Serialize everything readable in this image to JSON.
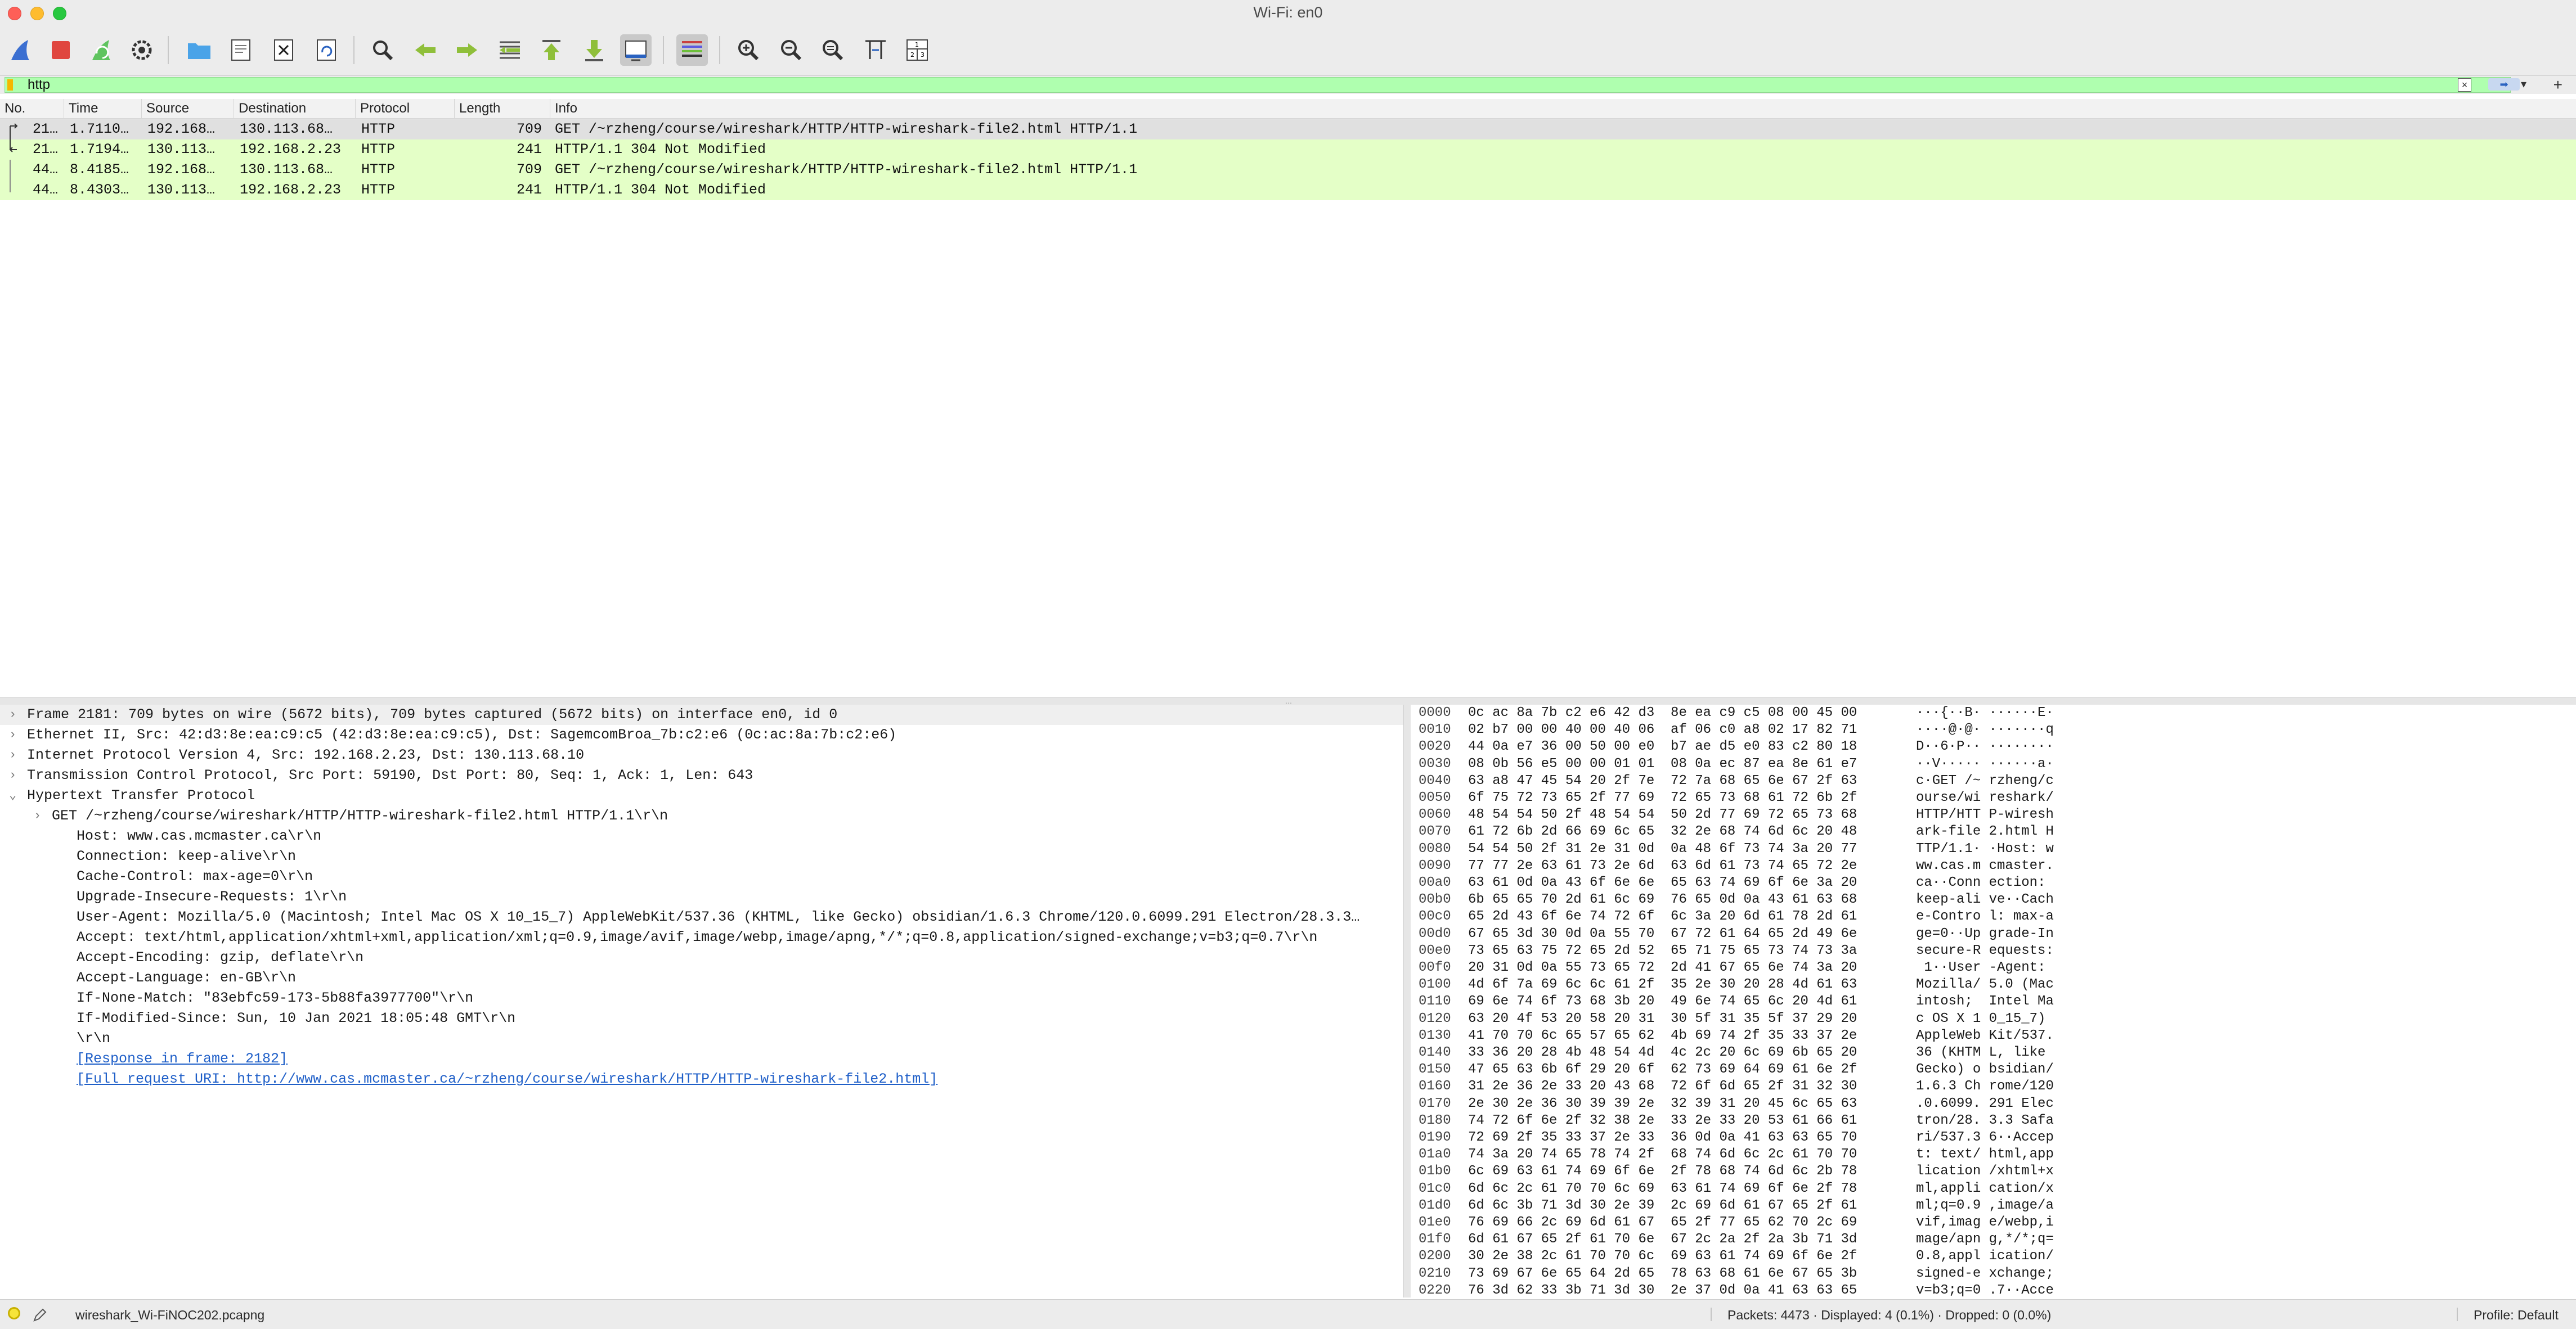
{
  "window": {
    "title": "Wi-Fi: en0"
  },
  "toolbar": {
    "buttons": [
      {
        "icon": "shark-fin-start-icon"
      },
      {
        "icon": "stop-capture-icon"
      },
      {
        "icon": "restart-capture-icon"
      },
      {
        "icon": "capture-options-icon"
      },
      {
        "icon": "open-file-icon"
      },
      {
        "icon": "save-file-icon"
      },
      {
        "icon": "close-file-icon"
      },
      {
        "icon": "reload-file-icon"
      },
      {
        "icon": "find-packet-icon"
      },
      {
        "icon": "go-back-icon"
      },
      {
        "icon": "go-forward-icon"
      },
      {
        "icon": "go-to-packet-icon"
      },
      {
        "icon": "first-packet-icon"
      },
      {
        "icon": "last-packet-icon"
      },
      {
        "icon": "autoscroll-icon"
      },
      {
        "icon": "colorize-icon"
      },
      {
        "icon": "zoom-in-icon"
      },
      {
        "icon": "zoom-out-icon"
      },
      {
        "icon": "normal-size-icon"
      },
      {
        "icon": "resize-columns-icon"
      },
      {
        "icon": "layout-icon"
      }
    ]
  },
  "filter": {
    "value": "http"
  },
  "packet_list": {
    "columns": [
      "No.",
      "Time",
      "Source",
      "Destination",
      "Protocol",
      "Length",
      "Info"
    ],
    "rows": [
      {
        "no": "21…",
        "time": "1.7110…",
        "src": "192.168…",
        "dst": "130.113.68…",
        "proto": "HTTP",
        "len": "709",
        "info": "GET /~rzheng/course/wireshark/HTTP/HTTP-wireshark-file2.html HTTP/1.1"
      },
      {
        "no": "21…",
        "time": "1.7194…",
        "src": "130.113…",
        "dst": "192.168.2.23",
        "proto": "HTTP",
        "len": "241",
        "info": "HTTP/1.1 304 Not Modified"
      },
      {
        "no": "44…",
        "time": "8.4185…",
        "src": "192.168…",
        "dst": "130.113.68…",
        "proto": "HTTP",
        "len": "709",
        "info": "GET /~rzheng/course/wireshark/HTTP/HTTP-wireshark-file2.html HTTP/1.1"
      },
      {
        "no": "44…",
        "time": "8.4303…",
        "src": "130.113…",
        "dst": "192.168.2.23",
        "proto": "HTTP",
        "len": "241",
        "info": "HTTP/1.1 304 Not Modified"
      }
    ]
  },
  "details": {
    "lines": [
      {
        "text": "Frame 2181: 709 bytes on wire (5672 bits), 709 bytes captured (5672 bits) on interface en0, id 0",
        "arrow": ">"
      },
      {
        "text": "Ethernet II, Src: 42:d3:8e:ea:c9:c5 (42:d3:8e:ea:c9:c5), Dst: SagemcomBroa_7b:c2:e6 (0c:ac:8a:7b:c2:e6)",
        "arrow": ">"
      },
      {
        "text": "Internet Protocol Version 4, Src: 192.168.2.23, Dst: 130.113.68.10",
        "arrow": ">"
      },
      {
        "text": "Transmission Control Protocol, Src Port: 59190, Dst Port: 80, Seq: 1, Ack: 1, Len: 643",
        "arrow": ">"
      },
      {
        "text": "Hypertext Transfer Protocol",
        "arrow": "v"
      },
      {
        "text": "GET /~rzheng/course/wireshark/HTTP/HTTP-wireshark-file2.html HTTP/1.1\\r\\n",
        "arrow": ">"
      },
      {
        "text": "Host: www.cas.mcmaster.ca\\r\\n",
        "arrow": ""
      },
      {
        "text": "Connection: keep-alive\\r\\n",
        "arrow": ""
      },
      {
        "text": "Cache-Control: max-age=0\\r\\n",
        "arrow": ""
      },
      {
        "text": "Upgrade-Insecure-Requests: 1\\r\\n",
        "arrow": ""
      },
      {
        "text": "User-Agent: Mozilla/5.0 (Macintosh; Intel Mac OS X 10_15_7) AppleWebKit/537.36 (KHTML, like Gecko) obsidian/1.6.3 Chrome/120.0.6099.291 Electron/28.3.3…",
        "arrow": ""
      },
      {
        "text": "Accept: text/html,application/xhtml+xml,application/xml;q=0.9,image/avif,image/webp,image/apng,*/*;q=0.8,application/signed-exchange;v=b3;q=0.7\\r\\n",
        "arrow": ""
      },
      {
        "text": "Accept-Encoding: gzip, deflate\\r\\n",
        "arrow": ""
      },
      {
        "text": "Accept-Language: en-GB\\r\\n",
        "arrow": ""
      },
      {
        "text": "If-None-Match: \"83ebfc59-173-5b88fa3977700\"\\r\\n",
        "arrow": ""
      },
      {
        "text": "If-Modified-Since: Sun, 10 Jan 2021 18:05:48 GMT\\r\\n",
        "arrow": ""
      },
      {
        "text": "\\r\\n",
        "arrow": ""
      },
      {
        "text": "[Response in frame: 2182]",
        "arrow": "",
        "link": true
      },
      {
        "text": "[Full request URI: http://www.cas.mcmaster.ca/~rzheng/course/wireshark/HTTP/HTTP-wireshark-file2.html]",
        "arrow": "",
        "link": true
      }
    ]
  },
  "hex": {
    "rows": [
      {
        "off": "0000",
        "hex": "0c ac 8a 7b c2 e6 42 d3  8e ea c9 c5 08 00 45 00",
        "ascii": "···{··B· ······E·"
      },
      {
        "off": "0010",
        "hex": "02 b7 00 00 40 00 40 06  af 06 c0 a8 02 17 82 71",
        "ascii": "····@·@· ·······q"
      },
      {
        "off": "0020",
        "hex": "44 0a e7 36 00 50 00 e0  b7 ae d5 e0 83 c2 80 18",
        "ascii": "D··6·P·· ········"
      },
      {
        "off": "0030",
        "hex": "08 0b 56 e5 00 00 01 01  08 0a ec 87 ea 8e 61 e7",
        "ascii": "··V····· ······a·"
      },
      {
        "off": "0040",
        "hex": "63 a8 47 45 54 20 2f 7e  72 7a 68 65 6e 67 2f 63",
        "ascii": "c·GET /~ rzheng/c"
      },
      {
        "off": "0050",
        "hex": "6f 75 72 73 65 2f 77 69  72 65 73 68 61 72 6b 2f",
        "ascii": "ourse/wi reshark/"
      },
      {
        "off": "0060",
        "hex": "48 54 54 50 2f 48 54 54  50 2d 77 69 72 65 73 68",
        "ascii": "HTTP/HTT P-wiresh"
      },
      {
        "off": "0070",
        "hex": "61 72 6b 2d 66 69 6c 65  32 2e 68 74 6d 6c 20 48",
        "ascii": "ark-file 2.html H"
      },
      {
        "off": "0080",
        "hex": "54 54 50 2f 31 2e 31 0d  0a 48 6f 73 74 3a 20 77",
        "ascii": "TTP/1.1· ·Host: w"
      },
      {
        "off": "0090",
        "hex": "77 77 2e 63 61 73 2e 6d  63 6d 61 73 74 65 72 2e",
        "ascii": "ww.cas.m cmaster."
      },
      {
        "off": "00a0",
        "hex": "63 61 0d 0a 43 6f 6e 6e  65 63 74 69 6f 6e 3a 20",
        "ascii": "ca··Conn ection: "
      },
      {
        "off": "00b0",
        "hex": "6b 65 65 70 2d 61 6c 69  76 65 0d 0a 43 61 63 68",
        "ascii": "keep-ali ve··Cach"
      },
      {
        "off": "00c0",
        "hex": "65 2d 43 6f 6e 74 72 6f  6c 3a 20 6d 61 78 2d 61",
        "ascii": "e-Contro l: max-a"
      },
      {
        "off": "00d0",
        "hex": "67 65 3d 30 0d 0a 55 70  67 72 61 64 65 2d 49 6e",
        "ascii": "ge=0··Up grade-In"
      },
      {
        "off": "00e0",
        "hex": "73 65 63 75 72 65 2d 52  65 71 75 65 73 74 73 3a",
        "ascii": "secure-R equests:"
      },
      {
        "off": "00f0",
        "hex": "20 31 0d 0a 55 73 65 72  2d 41 67 65 6e 74 3a 20",
        "ascii": " 1··User -Agent: "
      },
      {
        "off": "0100",
        "hex": "4d 6f 7a 69 6c 6c 61 2f  35 2e 30 20 28 4d 61 63",
        "ascii": "Mozilla/ 5.0 (Mac"
      },
      {
        "off": "0110",
        "hex": "69 6e 74 6f 73 68 3b 20  49 6e 74 65 6c 20 4d 61",
        "ascii": "intosh;  Intel Ma"
      },
      {
        "off": "0120",
        "hex": "63 20 4f 53 20 58 20 31  30 5f 31 35 5f 37 29 20",
        "ascii": "c OS X 1 0_15_7) "
      },
      {
        "off": "0130",
        "hex": "41 70 70 6c 65 57 65 62  4b 69 74 2f 35 33 37 2e",
        "ascii": "AppleWeb Kit/537."
      },
      {
        "off": "0140",
        "hex": "33 36 20 28 4b 48 54 4d  4c 2c 20 6c 69 6b 65 20",
        "ascii": "36 (KHTM L, like "
      },
      {
        "off": "0150",
        "hex": "47 65 63 6b 6f 29 20 6f  62 73 69 64 69 61 6e 2f",
        "ascii": "Gecko) o bsidian/"
      },
      {
        "off": "0160",
        "hex": "31 2e 36 2e 33 20 43 68  72 6f 6d 65 2f 31 32 30",
        "ascii": "1.6.3 Ch rome/120"
      },
      {
        "off": "0170",
        "hex": "2e 30 2e 36 30 39 39 2e  32 39 31 20 45 6c 65 63",
        "ascii": ".0.6099. 291 Elec"
      },
      {
        "off": "0180",
        "hex": "74 72 6f 6e 2f 32 38 2e  33 2e 33 20 53 61 66 61",
        "ascii": "tron/28. 3.3 Safa"
      },
      {
        "off": "0190",
        "hex": "72 69 2f 35 33 37 2e 33  36 0d 0a 41 63 63 65 70",
        "ascii": "ri/537.3 6··Accep"
      },
      {
        "off": "01a0",
        "hex": "74 3a 20 74 65 78 74 2f  68 74 6d 6c 2c 61 70 70",
        "ascii": "t: text/ html,app"
      },
      {
        "off": "01b0",
        "hex": "6c 69 63 61 74 69 6f 6e  2f 78 68 74 6d 6c 2b 78",
        "ascii": "lication /xhtml+x"
      },
      {
        "off": "01c0",
        "hex": "6d 6c 2c 61 70 70 6c 69  63 61 74 69 6f 6e 2f 78",
        "ascii": "ml,appli cation/x"
      },
      {
        "off": "01d0",
        "hex": "6d 6c 3b 71 3d 30 2e 39  2c 69 6d 61 67 65 2f 61",
        "ascii": "ml;q=0.9 ,image/a"
      },
      {
        "off": "01e0",
        "hex": "76 69 66 2c 69 6d 61 67  65 2f 77 65 62 70 2c 69",
        "ascii": "vif,imag e/webp,i"
      },
      {
        "off": "01f0",
        "hex": "6d 61 67 65 2f 61 70 6e  67 2c 2a 2f 2a 3b 71 3d",
        "ascii": "mage/apn g,*/*;q="
      },
      {
        "off": "0200",
        "hex": "30 2e 38 2c 61 70 70 6c  69 63 61 74 69 6f 6e 2f",
        "ascii": "0.8,appl ication/"
      },
      {
        "off": "0210",
        "hex": "73 69 67 6e 65 64 2d 65  78 63 68 61 6e 67 65 3b",
        "ascii": "signed-e xchange;"
      },
      {
        "off": "0220",
        "hex": "76 3d 62 33 3b 71 3d 30  2e 37 0d 0a 41 63 63 65",
        "ascii": "v=b3;q=0 .7··Acce"
      }
    ]
  },
  "status": {
    "file": "wireshark_Wi-FiNOC202.pcapng",
    "stats": "Packets: 4473 · Displayed: 4 (0.1%) · Dropped: 0 (0.0%)",
    "profile": "Profile: Default"
  },
  "colors": {
    "row_bg": "#e4ffc7",
    "row_selected": "#e0e0e0",
    "filter_valid": "#afffaf",
    "link": "#1f5fc8"
  }
}
